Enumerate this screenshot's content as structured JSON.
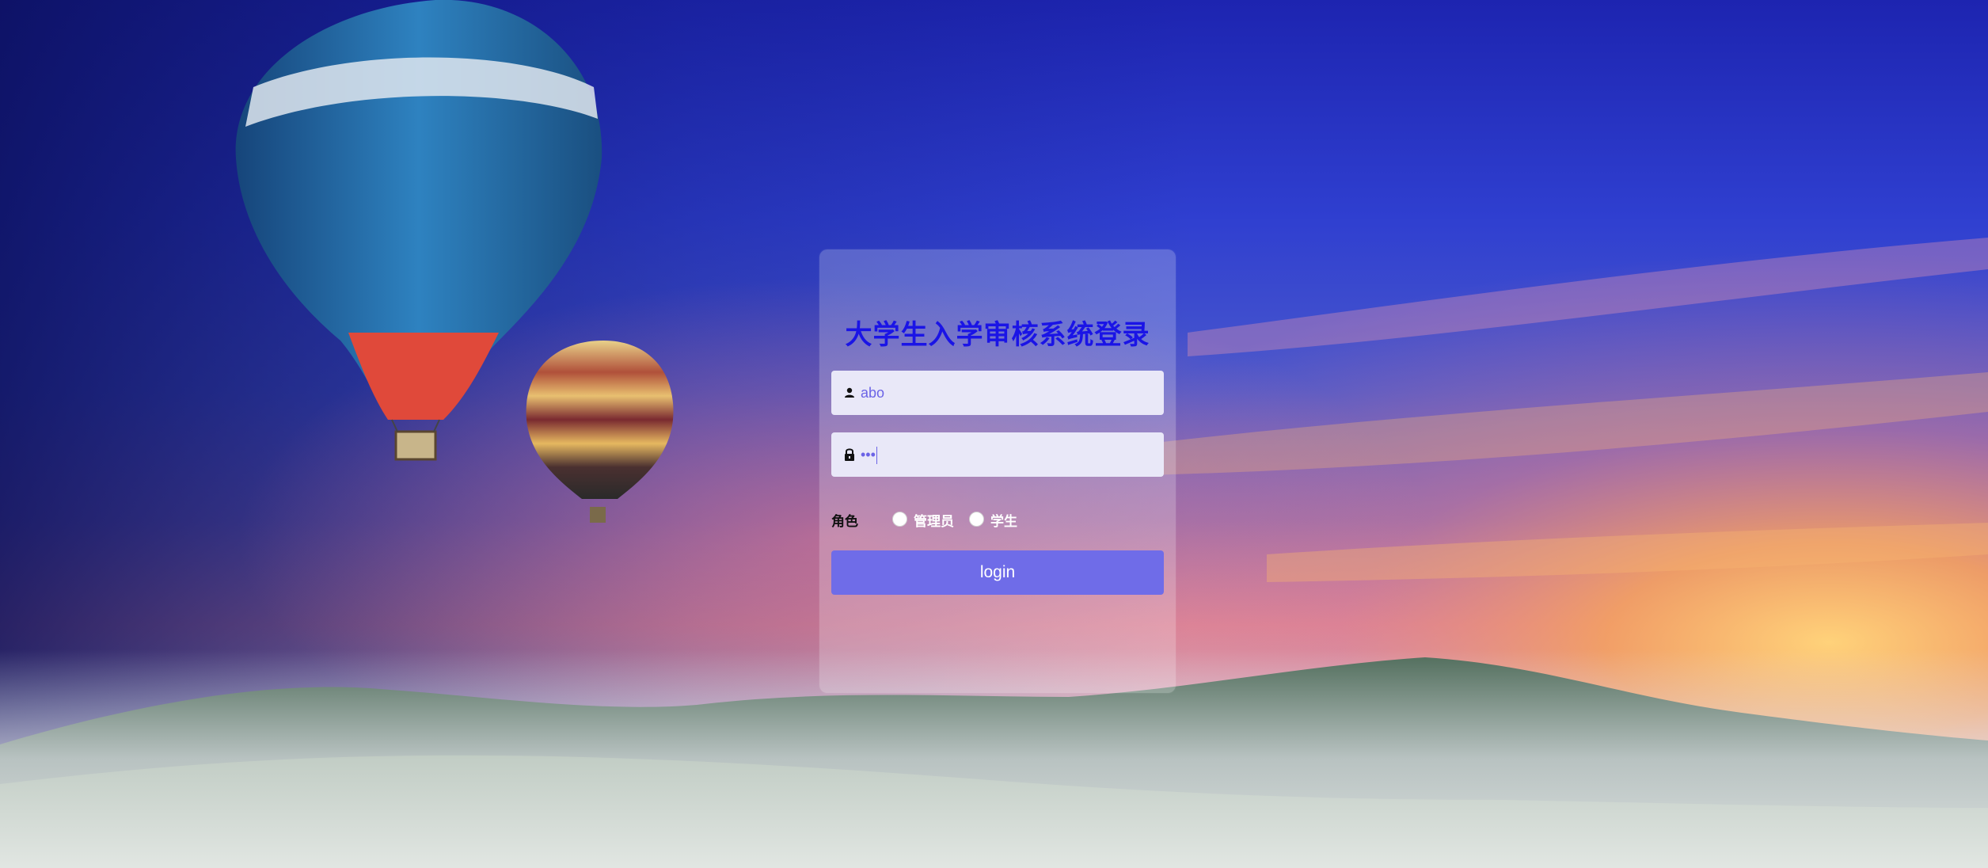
{
  "login": {
    "title": "大学生入学审核系统登录",
    "username": {
      "value": "abo",
      "icon": "user-icon"
    },
    "password": {
      "masked_value": "•••",
      "icon": "lock-icon"
    },
    "role": {
      "label": "角色",
      "options": [
        "管理员",
        "学生"
      ],
      "selected": null
    },
    "submit_label": "login"
  },
  "colors": {
    "title": "#1a14e6",
    "button": "#6f6ce8",
    "field_bg": "#e9e8f8",
    "field_text": "#6b63e6"
  }
}
